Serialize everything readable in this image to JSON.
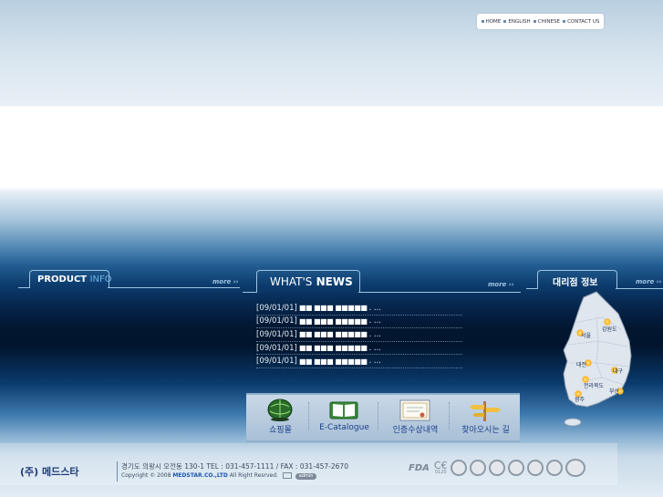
{
  "top_nav": [
    {
      "label": "HOME"
    },
    {
      "label": "ENGLISH"
    },
    {
      "label": "CHINESE"
    },
    {
      "label": "CONTACT US"
    }
  ],
  "product": {
    "title_bold": "PRODUCT",
    "title_light": "INFO",
    "more": "more ››"
  },
  "news": {
    "title_light": "WHAT'S",
    "title_bold": "NEWS",
    "more": "more ››",
    "items": [
      {
        "date": "[09/01/01]",
        "title": "■■ ■■■ ■■■■■",
        "suffix": ". ..."
      },
      {
        "date": "[09/01/01]",
        "title": "■■ ■■■ ■■■■■",
        "suffix": ". ..."
      },
      {
        "date": "[09/01/01]",
        "title": "■■ ■■■ ■■■■■",
        "suffix": ". ..."
      },
      {
        "date": "[09/01/01]",
        "title": "■■ ■■■ ■■■■■",
        "suffix": ". ..."
      },
      {
        "date": "[09/01/01]",
        "title": "■■ ■■■ ■■■■■",
        "suffix": ". ..."
      }
    ]
  },
  "dealer": {
    "title": "대리점 정보",
    "more": "more ››",
    "cities": [
      "서울",
      "강원도",
      "대전",
      "대구",
      "전라북도",
      "부산",
      "광주"
    ]
  },
  "quick_menu": [
    {
      "label": "쇼핑몰",
      "icon": "globe-icon"
    },
    {
      "label": "E-Catalogue",
      "icon": "book-icon"
    },
    {
      "label": "인증수상내역",
      "icon": "certificate-icon"
    },
    {
      "label": "찾아오시는 길",
      "icon": "signpost-icon"
    }
  ],
  "footer": {
    "company": "(주) 메드스타",
    "address": "경기도 의왕시 오전동 130-1   TEL : 031-457-1111 / FAX : 031-457-2670",
    "copyright_pre": "Copyright © 2008",
    "copyright_brand": "MEDSTAR.CO.,LTD",
    "copyright_post": "All Right Resrved.",
    "admin": "admin",
    "fda": "FDA",
    "ce": "C€",
    "ce_number": "0120"
  },
  "colors": {
    "accent_line": "#9cc4e4",
    "quick_label": "#1a3f8b",
    "brand": "#1c56b0"
  }
}
